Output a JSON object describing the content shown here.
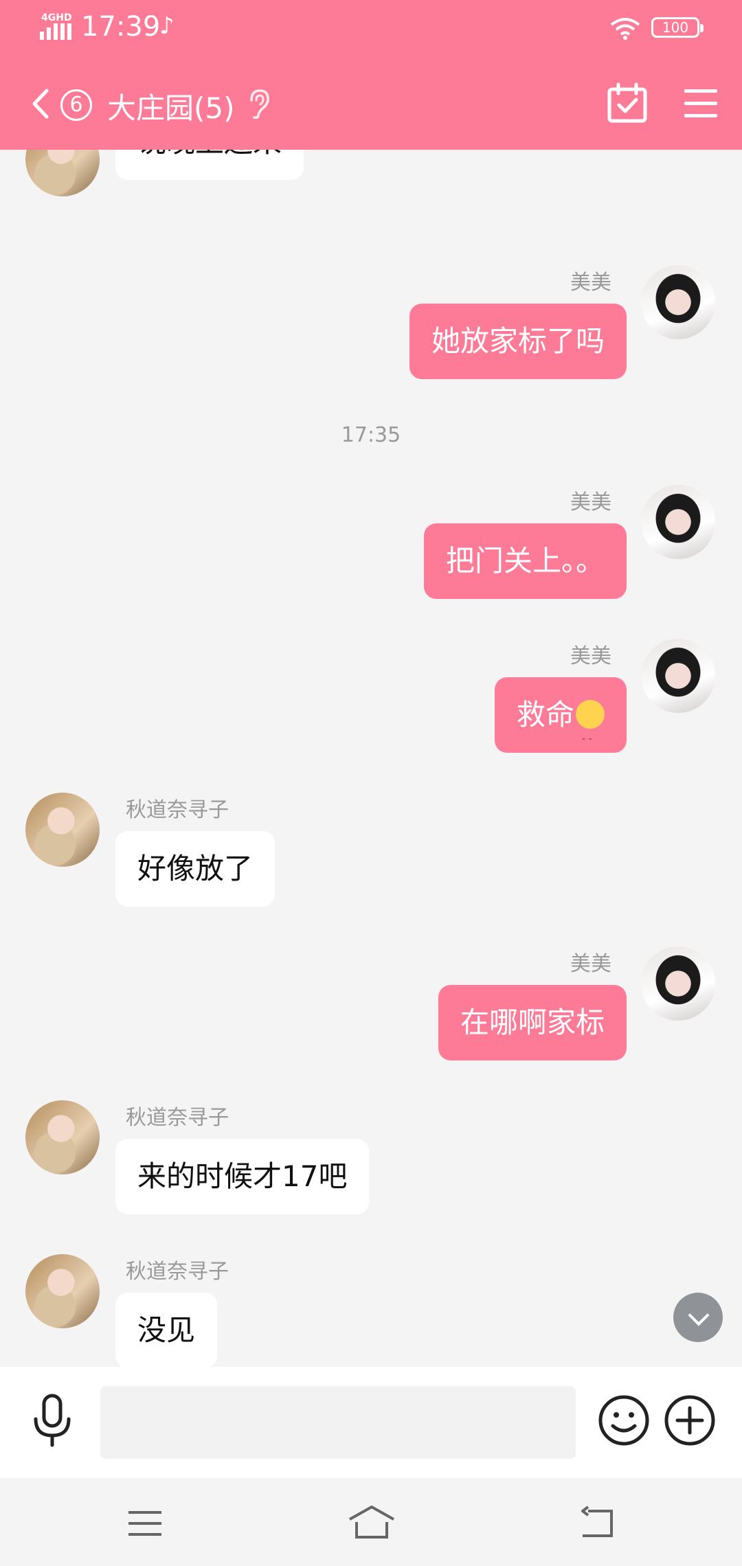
{
  "status_bar": {
    "network": "4GHD",
    "time": "17:39",
    "tiktok_icon": "tiktok-icon",
    "battery": "100"
  },
  "header": {
    "back_icon": "chevron-left-icon",
    "unread_count": "6",
    "title": "大庄园(5)",
    "ear_icon": "ear-icon",
    "calendar_icon": "calendar-check-icon",
    "menu_icon": "menu-icon",
    "bg_color": "#fe7b98"
  },
  "messages": [
    {
      "side": "left",
      "sender": "",
      "text": "说晚上还来"
    },
    {
      "side": "right",
      "sender": "美美",
      "text": "她放家标了吗"
    },
    {
      "timestamp": "17:35"
    },
    {
      "side": "right",
      "sender": "美美",
      "text": "把门关上。。"
    },
    {
      "side": "right",
      "sender": "美美",
      "text": "救命",
      "emoji": "unamused-face-icon"
    },
    {
      "side": "left",
      "sender": "秋道奈寻子",
      "text": "好像放了"
    },
    {
      "side": "right",
      "sender": "美美",
      "text": "在哪啊家标"
    },
    {
      "side": "left",
      "sender": "秋道奈寻子",
      "text": "来的时候才17吧"
    },
    {
      "side": "left",
      "sender": "秋道奈寻子",
      "text": "没见"
    }
  ],
  "input_bar": {
    "mic_icon": "microphone-icon",
    "input_value": "",
    "emoji_icon": "smiley-icon",
    "plus_icon": "plus-circle-icon"
  },
  "system_nav": {
    "menu_icon": "recent-apps-icon",
    "home_icon": "home-icon",
    "back_icon": "back-icon"
  }
}
